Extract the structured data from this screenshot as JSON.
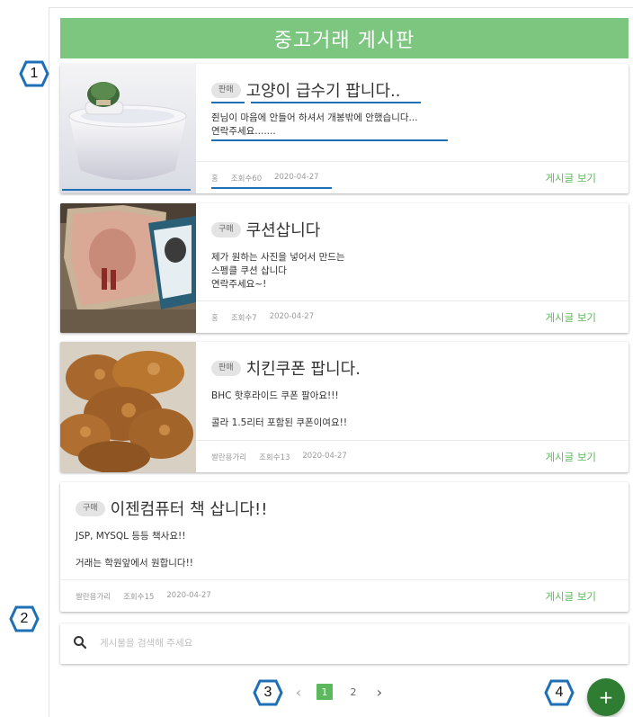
{
  "board": {
    "title": "중고거래 게시판"
  },
  "posts": [
    {
      "tag": "판매",
      "title": "고양이 급수기 팝니다..",
      "description": "쥔님이 마음에 안들어 하셔서 개봉밖에 안했습니다...\n연락주세요.......",
      "author": "홍",
      "views": "조회수60",
      "date": "2020-04-27",
      "view_label": "게시글 보기"
    },
    {
      "tag": "구매",
      "title": "쿠션삽니다",
      "description": "제가 원하는 사진을 넣어서 만드는\n스펭클 쿠션 삽니다\n연락주세요~!",
      "author": "홍",
      "views": "조회수7",
      "date": "2020-04-27",
      "view_label": "게시글 보기"
    },
    {
      "tag": "판매",
      "title": "치킨쿠폰 팝니다.",
      "description": "BHC 핫후라이드 쿠폰 팔아요!!!\n\n콜라 1.5리터 포함된 쿠폰이여요!!",
      "author": "쌀란용가리",
      "views": "조회수13",
      "date": "2020-04-27",
      "view_label": "게시글 보기"
    },
    {
      "tag": "구매",
      "title": "이젠컴퓨터 책 삽니다!!",
      "description": "JSP, MYSQL 등등 책사요!!\n\n거래는 학원앞에서 원합니다!!",
      "author": "쌀란용가리",
      "views": "조회수15",
      "date": "2020-04-27",
      "view_label": "게시글 보기"
    }
  ],
  "search": {
    "placeholder": "게시물을 검색해 주세요",
    "value": ""
  },
  "pagination": {
    "prev": "‹",
    "pages": [
      "1",
      "2"
    ],
    "current": "1",
    "next": "›"
  },
  "fab": {
    "label": "+"
  },
  "annotations": [
    "1",
    "2",
    "3",
    "4"
  ],
  "colors": {
    "header_bg": "#7dc67f",
    "accent_green": "#5cb85c",
    "fab_bg": "#2e7d32",
    "annotation_blue": "#1e6fb5"
  }
}
